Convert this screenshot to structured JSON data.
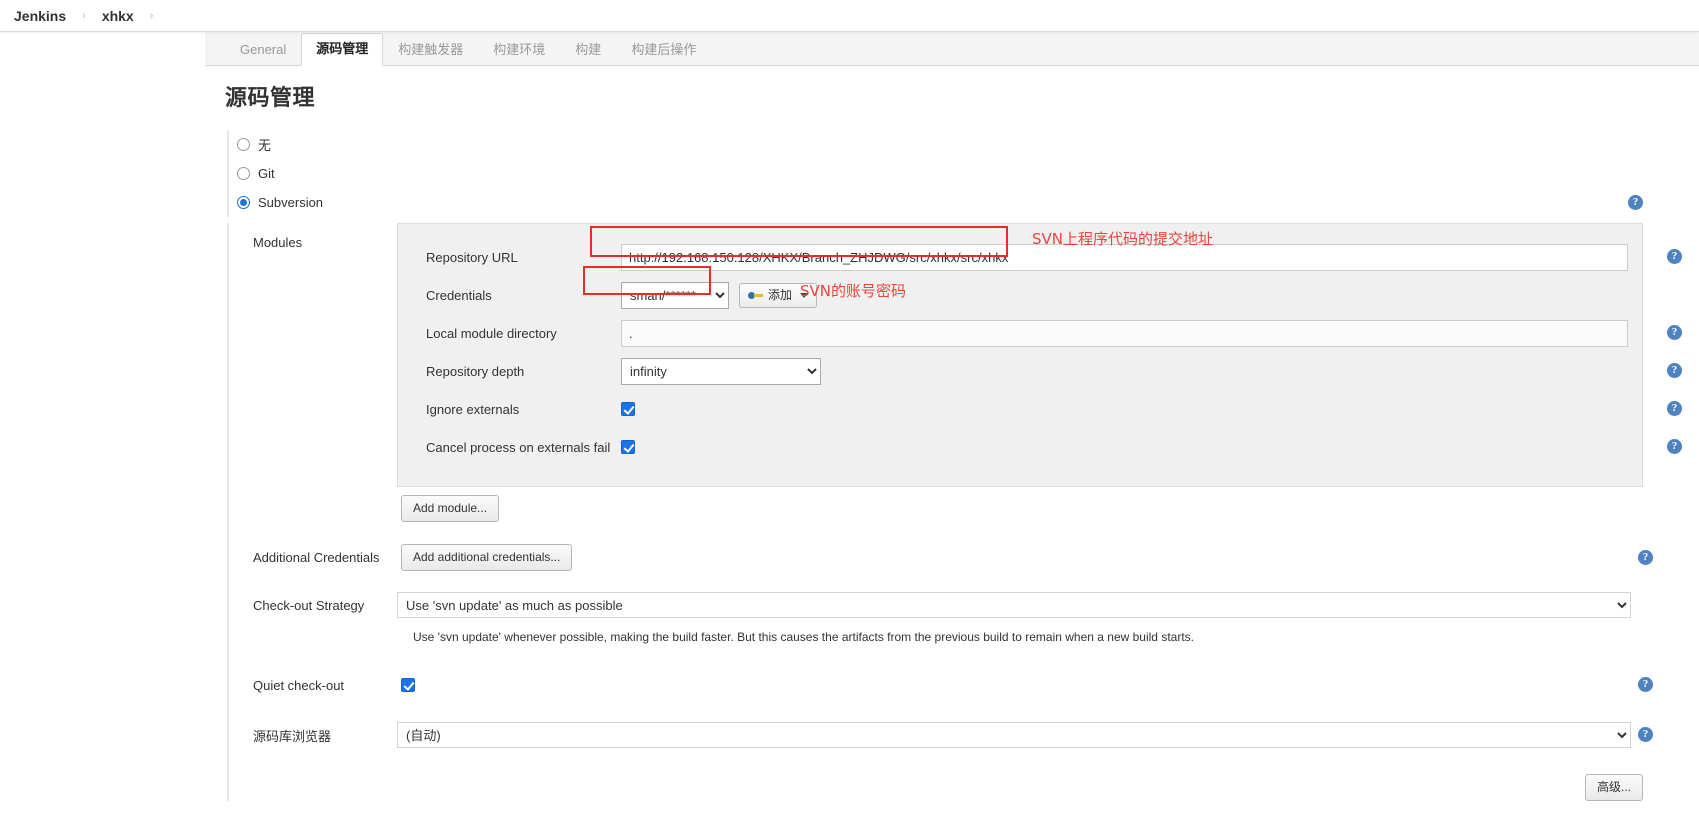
{
  "breadcrumb": {
    "items": [
      "Jenkins",
      "xhkx"
    ],
    "separator": "›"
  },
  "tabs": [
    {
      "label": "General",
      "active": false
    },
    {
      "label": "源码管理",
      "active": true
    },
    {
      "label": "构建触发器",
      "active": false
    },
    {
      "label": "构建环境",
      "active": false
    },
    {
      "label": "构建",
      "active": false
    },
    {
      "label": "构建后操作",
      "active": false
    }
  ],
  "page_title": "源码管理",
  "scm_options": [
    {
      "label": "无",
      "selected": false
    },
    {
      "label": "Git",
      "selected": false
    },
    {
      "label": "Subversion",
      "selected": true
    }
  ],
  "modules": {
    "label": "Modules",
    "repository_url": {
      "label": "Repository URL",
      "value": "http://192.168.150.128/XHKX/Branch_ZHJDWG/src/xhkx/src/xhkx"
    },
    "credentials": {
      "label": "Credentials",
      "value": "sman/******",
      "add_button": "添加"
    },
    "local_module_directory": {
      "label": "Local module directory",
      "value": "."
    },
    "repository_depth": {
      "label": "Repository depth",
      "value": "infinity"
    },
    "ignore_externals": {
      "label": "Ignore externals",
      "checked": true
    },
    "cancel_process_on_externals_fail": {
      "label": "Cancel process on externals fail",
      "checked": true
    },
    "add_module_button": "Add module..."
  },
  "additional_credentials": {
    "label": "Additional Credentials",
    "button": "Add additional credentials..."
  },
  "checkout_strategy": {
    "label": "Check-out Strategy",
    "value": "Use 'svn update' as much as possible",
    "description": "Use 'svn update' whenever possible, making the build faster. But this causes the artifacts from the previous build to remain when a new build starts."
  },
  "quiet_checkout": {
    "label": "Quiet check-out",
    "checked": true
  },
  "repository_browser": {
    "label": "源码库浏览器",
    "value": "(自动)"
  },
  "advanced_button": "高级...",
  "annotations": [
    {
      "text": "SVN上程序代码的提交地址"
    },
    {
      "text": "SVN的账号密码"
    }
  ],
  "icons": {
    "help": "?",
    "key": "key-icon"
  },
  "colors": {
    "accent": "#1d72d2",
    "annotation_red": "#e8463c",
    "help_blue": "#4f82c0",
    "panel_gray": "#f0f0f0"
  }
}
